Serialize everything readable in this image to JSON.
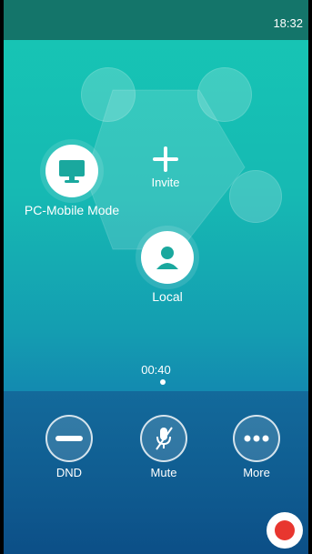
{
  "statusbar": {
    "time": "18:32"
  },
  "conference": {
    "invite_label": "Invite",
    "members": [
      {
        "label": "PC-Mobile Mode",
        "icon": "monitor-icon"
      },
      {
        "label": "Local",
        "icon": "person-icon"
      }
    ],
    "timer": "00:40"
  },
  "controls": {
    "dnd_label": "DND",
    "mute_label": "Mute",
    "more_label": "More"
  },
  "colors": {
    "statusbar": "#14756a",
    "top_gradient": "#17c7b4",
    "bottom_bar": "#0f5b90",
    "record_red": "#e8362f"
  }
}
